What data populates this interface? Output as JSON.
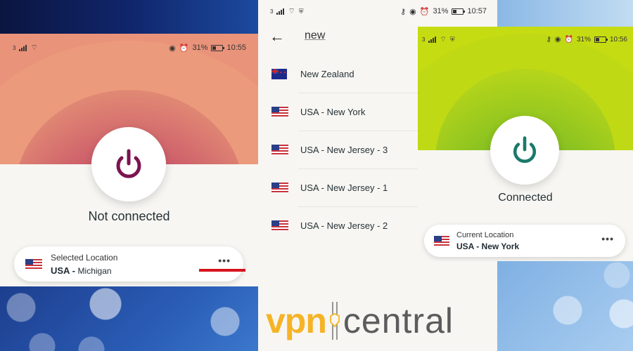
{
  "phone_disconnected": {
    "status_bar": {
      "carrier": "3",
      "battery": "31%",
      "time": "10:55",
      "icons": [
        "signal-icon",
        "wifi-icon",
        "eye-icon",
        "alarm-icon",
        "battery-icon"
      ]
    },
    "power_button": {
      "icon": "power-icon",
      "color": "#7b1450"
    },
    "status": "Not connected",
    "location_card": {
      "title": "Selected Location",
      "country": "USA -",
      "city": "Michigan",
      "flag": "flag-usa",
      "more": "•••",
      "highlight_color": "#d7141e"
    }
  },
  "phone_search": {
    "status_bar": {
      "carrier": "3",
      "battery": "31%",
      "time": "10:57",
      "icons": [
        "signal-icon",
        "wifi-icon",
        "vpn-key-icon",
        "eye-icon",
        "alarm-icon",
        "battery-icon"
      ]
    },
    "back": "←",
    "search_value": "new",
    "results": [
      {
        "flag": "flag-new-zealand",
        "label": "New Zealand"
      },
      {
        "flag": "flag-usa",
        "label": "USA - New York"
      },
      {
        "flag": "flag-usa",
        "label": "USA - New Jersey - 3"
      },
      {
        "flag": "flag-usa",
        "label": "USA - New Jersey - 1"
      },
      {
        "flag": "flag-usa",
        "label": "USA - New Jersey - 2"
      }
    ]
  },
  "phone_connected": {
    "status_bar": {
      "carrier": "3",
      "battery": "31%",
      "time": "10:56",
      "icons": [
        "signal-icon",
        "wifi-icon",
        "vpn-key-icon",
        "eye-icon",
        "alarm-icon",
        "battery-icon"
      ]
    },
    "power_button": {
      "icon": "power-icon",
      "color": "#1a7a6a"
    },
    "status": "Connected",
    "location_card": {
      "title": "Current Location",
      "value": "USA - New York",
      "flag": "flag-usa",
      "more": "•••"
    }
  },
  "watermark": {
    "part1": "vpn",
    "part2": "central",
    "colors": {
      "vpn": "#f5b427",
      "central": "#5c5c5c"
    }
  }
}
